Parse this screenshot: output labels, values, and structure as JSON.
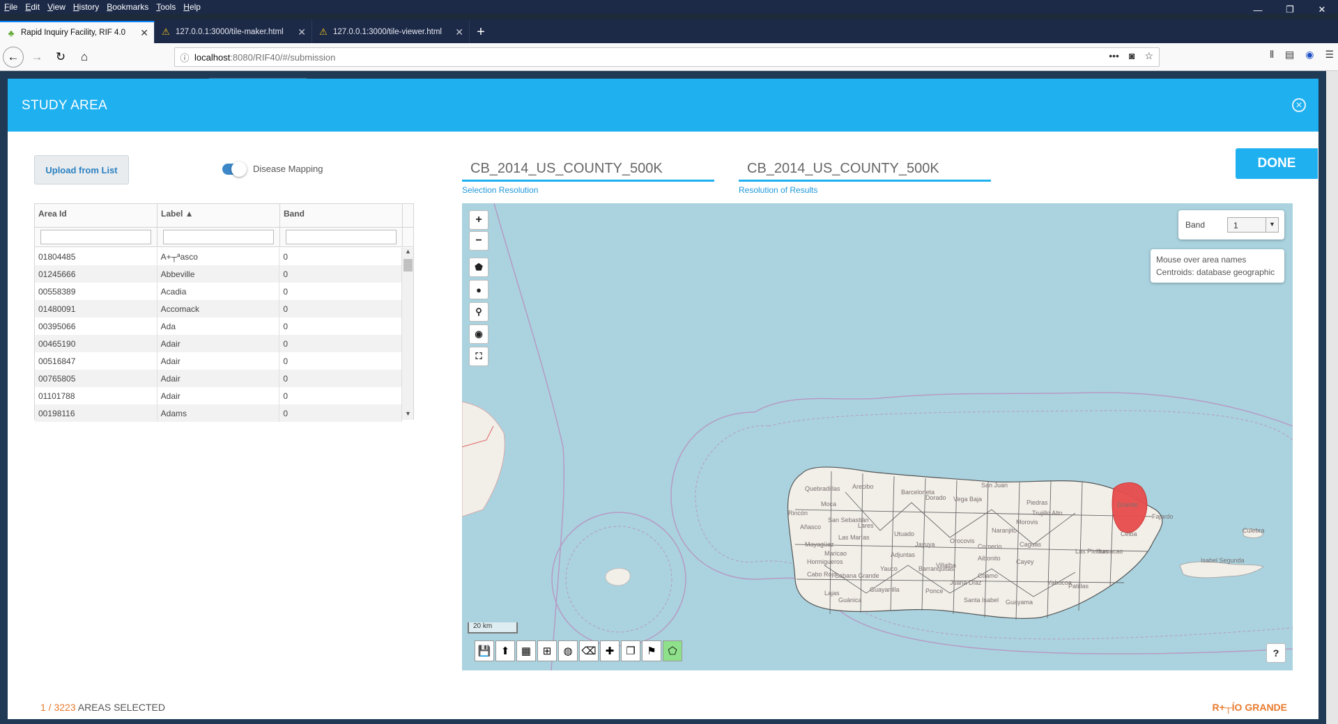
{
  "menubar": [
    "File",
    "Edit",
    "View",
    "History",
    "Bookmarks",
    "Tools",
    "Help"
  ],
  "window_controls": {
    "minimize": "—",
    "restore": "❐",
    "close": "✕"
  },
  "tabs": [
    {
      "label": "Rapid Inquiry Facility, RIF 4.0",
      "icon": "tree-icon"
    },
    {
      "label": "127.0.0.1:3000/tile-maker.html",
      "icon": "warning-icon"
    },
    {
      "label": "127.0.0.1:3000/tile-viewer.html",
      "icon": "warning-icon"
    }
  ],
  "url": {
    "host": "localhost",
    "path": ":8080/RIF40/#/submission"
  },
  "modal": {
    "title": "STUDY AREA",
    "upload_label": "Upload from List",
    "toggle_label": "Disease Mapping",
    "selection_resolution": {
      "value": "CB_2014_US_COUNTY_500K",
      "label": "Selection Resolution"
    },
    "results_resolution": {
      "value": "CB_2014_US_COUNTY_500K",
      "label": "Resolution of Results"
    },
    "done_label": "DONE",
    "grid": {
      "columns": [
        "Area Id",
        "Label ▲",
        "Band"
      ],
      "rows": [
        [
          "01804485",
          "A+┬ªasco",
          "0"
        ],
        [
          "01245666",
          "Abbeville",
          "0"
        ],
        [
          "00558389",
          "Acadia",
          "0"
        ],
        [
          "01480091",
          "Accomack",
          "0"
        ],
        [
          "00395066",
          "Ada",
          "0"
        ],
        [
          "00465190",
          "Adair",
          "0"
        ],
        [
          "00516847",
          "Adair",
          "0"
        ],
        [
          "00765805",
          "Adair",
          "0"
        ],
        [
          "01101788",
          "Adair",
          "0"
        ],
        [
          "00198116",
          "Adams",
          "0"
        ]
      ]
    },
    "map": {
      "band_label": "Band",
      "band_value": "1",
      "info_lines": [
        "Mouse over area names",
        "Centroids: database geographic"
      ],
      "scale": "20 km",
      "help": "?",
      "place_labels": [
        "Quebradillas",
        "Arecibo",
        "San Juan",
        "Barceloneta",
        "Vega Baja",
        "Dorado",
        "Piedras",
        "Trujillo Alto",
        "Grande",
        "Fajardo",
        "Culebra",
        "Isabel Segunda",
        "Mayagüez",
        "Hormigueros",
        "Cabo Rojo",
        "Sabana Grande",
        "Ponce",
        "Santa Isabel",
        "Guayama",
        "Yabucoa",
        "Caguas",
        "Cayey",
        "Coamo",
        "Utuado",
        "Adjuntas",
        "Jayuya",
        "Orocovis",
        "Barranquitas",
        "Naranjito",
        "Humacao",
        "Rincón",
        "Añasco",
        "San Sebastián",
        "Lares",
        "Las Marías",
        "Maricao",
        "Lajas",
        "Guánica",
        "Yauco",
        "Guayanilla",
        "Juana Díaz",
        "Villalba",
        "Aibonito",
        "Comerío",
        "Patillas",
        "Las Piedras",
        "Ceiba",
        "Moca",
        "Morovis"
      ]
    },
    "footer": {
      "selected": "1 / 3223",
      "suffix": " AREAS SELECTED",
      "selected_name": "R+┬ÍO GRANDE"
    }
  },
  "colors": {
    "accent": "#1fb0f0",
    "highlight": "#e84c4c",
    "orange": "#e87a2d"
  }
}
